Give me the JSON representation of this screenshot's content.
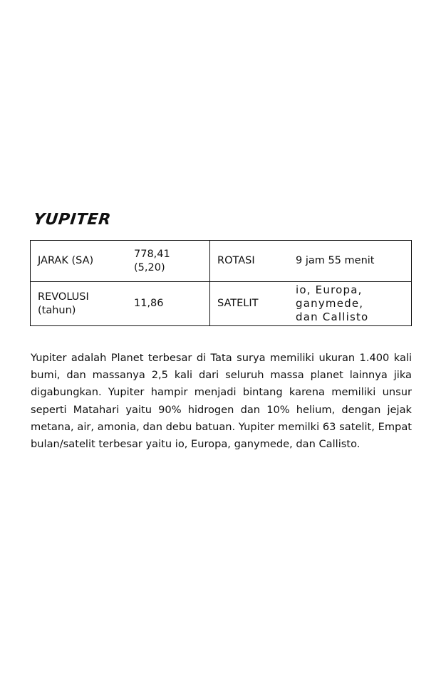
{
  "title": "YUPITER",
  "table": {
    "row1": {
      "label_left": "JARAK (SA)",
      "value_left_line1": "778,41",
      "value_left_line2": "(5,20)",
      "label_right": "ROTASI",
      "value_right": "9 jam 55 menit"
    },
    "row2": {
      "label_left_line1": "REVOLUSI",
      "label_left_line2": "(tahun)",
      "value_left": "11,86",
      "label_right": "SATELIT",
      "value_right_line1": "io, Europa,",
      "value_right_line2": "ganymede,",
      "value_right_line3": "dan Callisto"
    }
  },
  "description": "Yupiter adalah Planet terbesar di Tata surya memiliki ukuran 1.400 kali bumi, dan massanya 2,5 kali dari seluruh massa planet lainnya jika digabungkan. Yupiter hampir menjadi bintang karena memiliki unsur seperti Matahari yaitu  90% hidrogen dan 10% helium, dengan jejak metana, air, amonia, dan debu batuan. Yupiter memilki 63 satelit, Empat bulan/satelit terbesar yaitu io, Europa, ganymede, dan Callisto."
}
